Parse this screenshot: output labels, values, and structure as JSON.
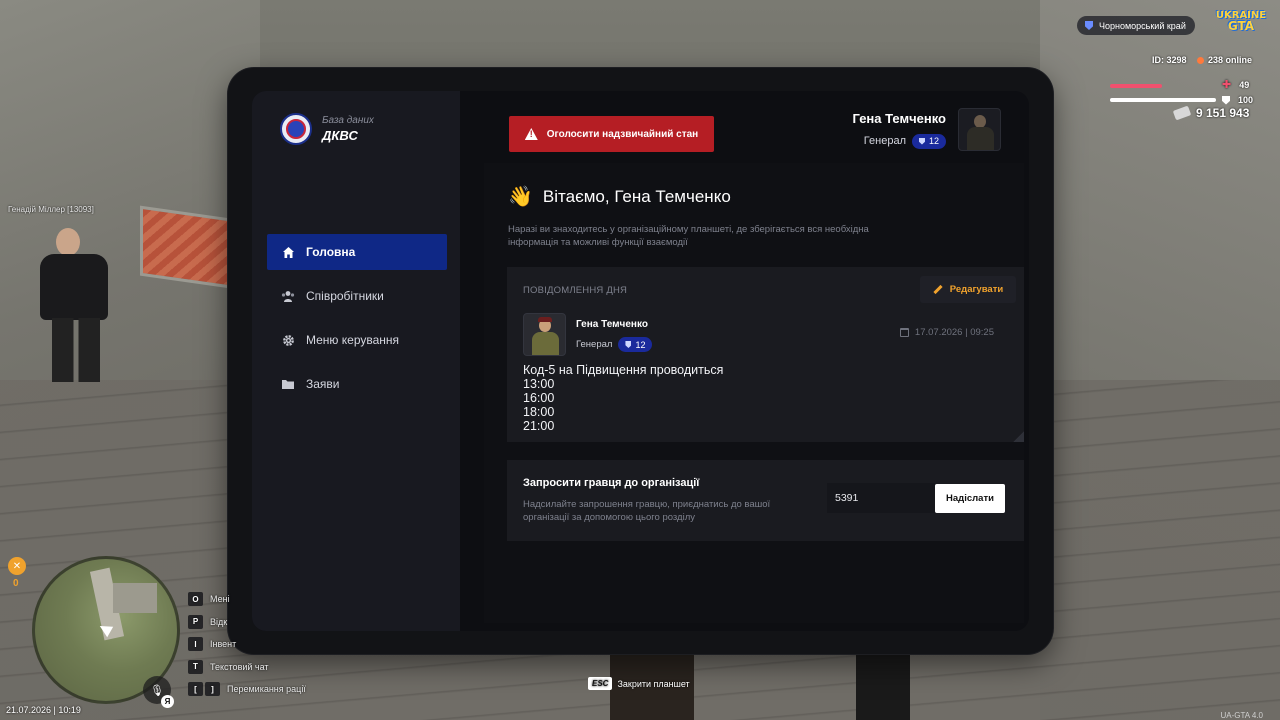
{
  "hud": {
    "region": "Чорноморський край",
    "logo_line1": "UKRAINE",
    "logo_line2": "GTA",
    "player_id": "ID: 3298",
    "online": "238 online",
    "health": "49",
    "health_level": 0.49,
    "armor": "100",
    "armor_level": 1.0,
    "money": "9 151 943",
    "hunger": "0",
    "datetime": "21.07.2026 | 10:19",
    "version": "UA-GTA 4.0",
    "mic_lang": "Я",
    "npc_label": "Генадій Міллер [13093]",
    "esc_key": "ESC",
    "esc_label": "Закрити планшет",
    "keybinds": [
      {
        "key": "O",
        "label": "Мені"
      },
      {
        "key": "P",
        "label": "Відк"
      },
      {
        "key": "I",
        "label": "Інвент"
      },
      {
        "key": "T",
        "label": "Текстовий чат"
      },
      {
        "key": "[",
        "key2": "]",
        "label": "Перемикання рації"
      }
    ]
  },
  "tablet": {
    "brand_sub": "База даних",
    "brand_title": "ДКВС",
    "alarm_button": "Оголосити надзвичайний стан",
    "profile": {
      "name": "Гена Темченко",
      "rank": "Генерал",
      "level": "12"
    },
    "nav": [
      {
        "label": "Головна",
        "icon": "home-icon",
        "active": true
      },
      {
        "label": "Співробітники",
        "icon": "users-icon",
        "active": false
      },
      {
        "label": "Меню керування",
        "icon": "gear-icon",
        "active": false
      },
      {
        "label": "Заяви",
        "icon": "folder-icon",
        "active": false
      }
    ],
    "greeting": "Вітаємо, Гена Темченко",
    "intro": "Наразі ви знаходитесь у організаційному планшеті, де зберігається вся необхідна інформація та можливі функції взаємодії",
    "motd": {
      "title": "ПОВІДОМЛЕННЯ ДНЯ",
      "edit_label": "Редагувати",
      "author_name": "Гена Темченко",
      "author_rank": "Генерал",
      "author_level": "12",
      "date": "17.07.2026 | 09:25",
      "body": "Код-5 на Підвищення проводиться\n13:00\n16:00\n18:00\n21:00"
    },
    "invite": {
      "title": "Запросити гравця до організації",
      "desc": "Надсилайте запрошення гравцю, приєднатись до вашої організації за допомогою цього розділу",
      "input_value": "5391",
      "send_label": "Надіслати"
    }
  },
  "colors": {
    "accent_blue": "#0f2886",
    "alarm_red": "#b51e24",
    "edit_orange": "#f0a22d",
    "hp_red": "#f0506e"
  }
}
